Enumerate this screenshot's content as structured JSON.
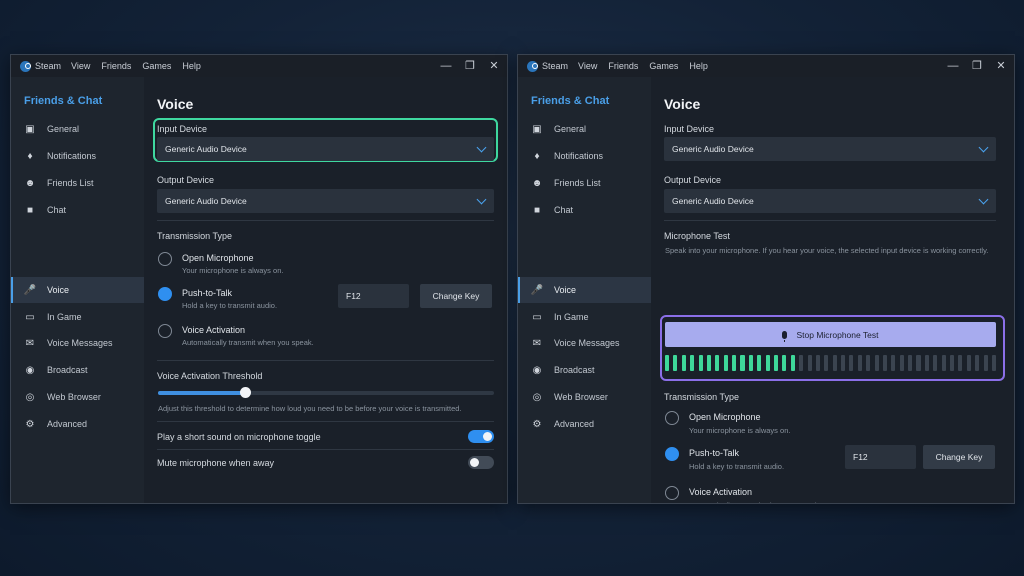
{
  "title_menu": [
    "Steam",
    "View",
    "Friends",
    "Games",
    "Help"
  ],
  "window_controls": [
    "minimize-icon",
    "maximize-icon",
    "close-icon"
  ],
  "sidebar": {
    "title": "Friends & Chat",
    "items": [
      {
        "label": "General",
        "icon": "general-icon"
      },
      {
        "label": "Notifications",
        "icon": "bell-icon"
      },
      {
        "label": "Friends List",
        "icon": "friends-icon"
      },
      {
        "label": "Chat",
        "icon": "chat-icon"
      },
      {
        "label": "Voice",
        "icon": "microphone-icon",
        "active": true
      },
      {
        "label": "In Game",
        "icon": "monitor-icon"
      },
      {
        "label": "Voice Messages",
        "icon": "voice-message-icon"
      },
      {
        "label": "Broadcast",
        "icon": "broadcast-icon"
      },
      {
        "label": "Web Browser",
        "icon": "globe-icon"
      },
      {
        "label": "Advanced",
        "icon": "gear-icon"
      }
    ]
  },
  "voice": {
    "heading": "Voice",
    "input_label": "Input Device",
    "input_value": "Generic Audio Device",
    "output_label": "Output Device",
    "output_value": "Generic Audio Device",
    "transmission_label": "Transmission Type",
    "open_mic_label": "Open Microphone",
    "open_mic_desc": "Your microphone is always on.",
    "ptt_label": "Push-to-Talk",
    "ptt_desc": "Hold a key to transmit audio.",
    "ptt_key": "F12",
    "change_key_label": "Change Key",
    "va_label": "Voice Activation",
    "va_desc": "Automatically transmit when you speak.",
    "threshold_label": "Voice Activation Threshold",
    "threshold_value_fraction": 0.26,
    "threshold_desc": "Adjust this threshold to determine how loud you need to be before your voice is transmitted.",
    "toggle_sound_label": "Play a short sound on microphone toggle",
    "toggle_sound_on": true,
    "mute_away_label": "Mute microphone when away",
    "mute_away_on": false,
    "mic_test_label": "Microphone Test",
    "mic_test_desc": "Speak into your microphone. If you hear your voice, the selected input device is working correctly.",
    "stop_test_label": "Stop Microphone Test",
    "meter_total_bars": 40,
    "meter_lit_bars": 16
  },
  "colors": {
    "accent": "#4a9fe8",
    "highlight_left": "#3fd8a0",
    "highlight_right": "#8b6fe8",
    "meter_lit": "#3ed89a"
  }
}
